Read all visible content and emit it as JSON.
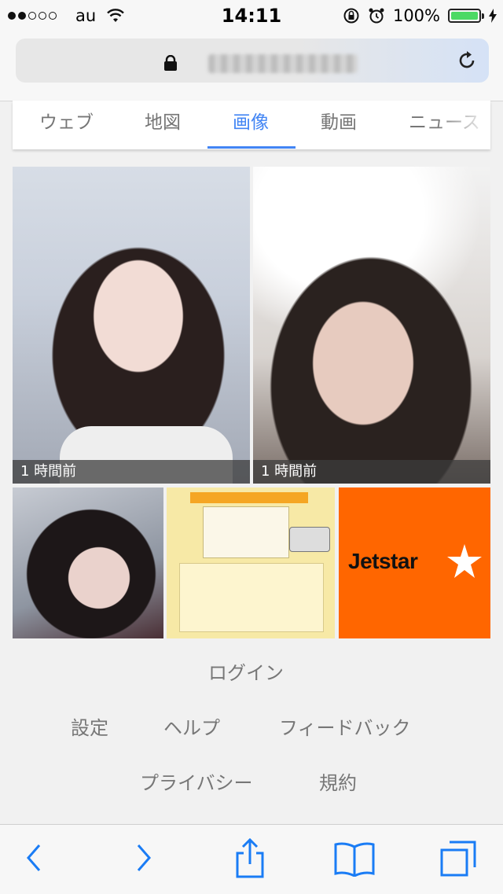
{
  "status_bar": {
    "carrier": "au",
    "time": "14:11",
    "battery_percent": "100%",
    "battery_level": 1.0,
    "signal_bars_filled": 2,
    "signal_bars_total": 5
  },
  "address_bar": {
    "url_obscured": true
  },
  "tabs": [
    {
      "label": "ウェブ",
      "active": false
    },
    {
      "label": "地図",
      "active": false
    },
    {
      "label": "画像",
      "active": true
    },
    {
      "label": "動画",
      "active": false
    },
    {
      "label": "ニュース",
      "active": false
    }
  ],
  "results": [
    {
      "caption": "1 時間前"
    },
    {
      "caption": "1 時間前"
    },
    {
      "caption": ""
    },
    {
      "caption": ""
    },
    {
      "logo_text": "Jetstar"
    }
  ],
  "footer": {
    "login": "ログイン",
    "settings": "設定",
    "help": "ヘルプ",
    "feedback": "フィードバック",
    "privacy": "プライバシー",
    "terms": "規約"
  },
  "colors": {
    "accent": "#4285f4",
    "battery": "#4cd964",
    "jetstar_bg": "#ff6600",
    "toolbar_icons": "#1a7cf5"
  }
}
